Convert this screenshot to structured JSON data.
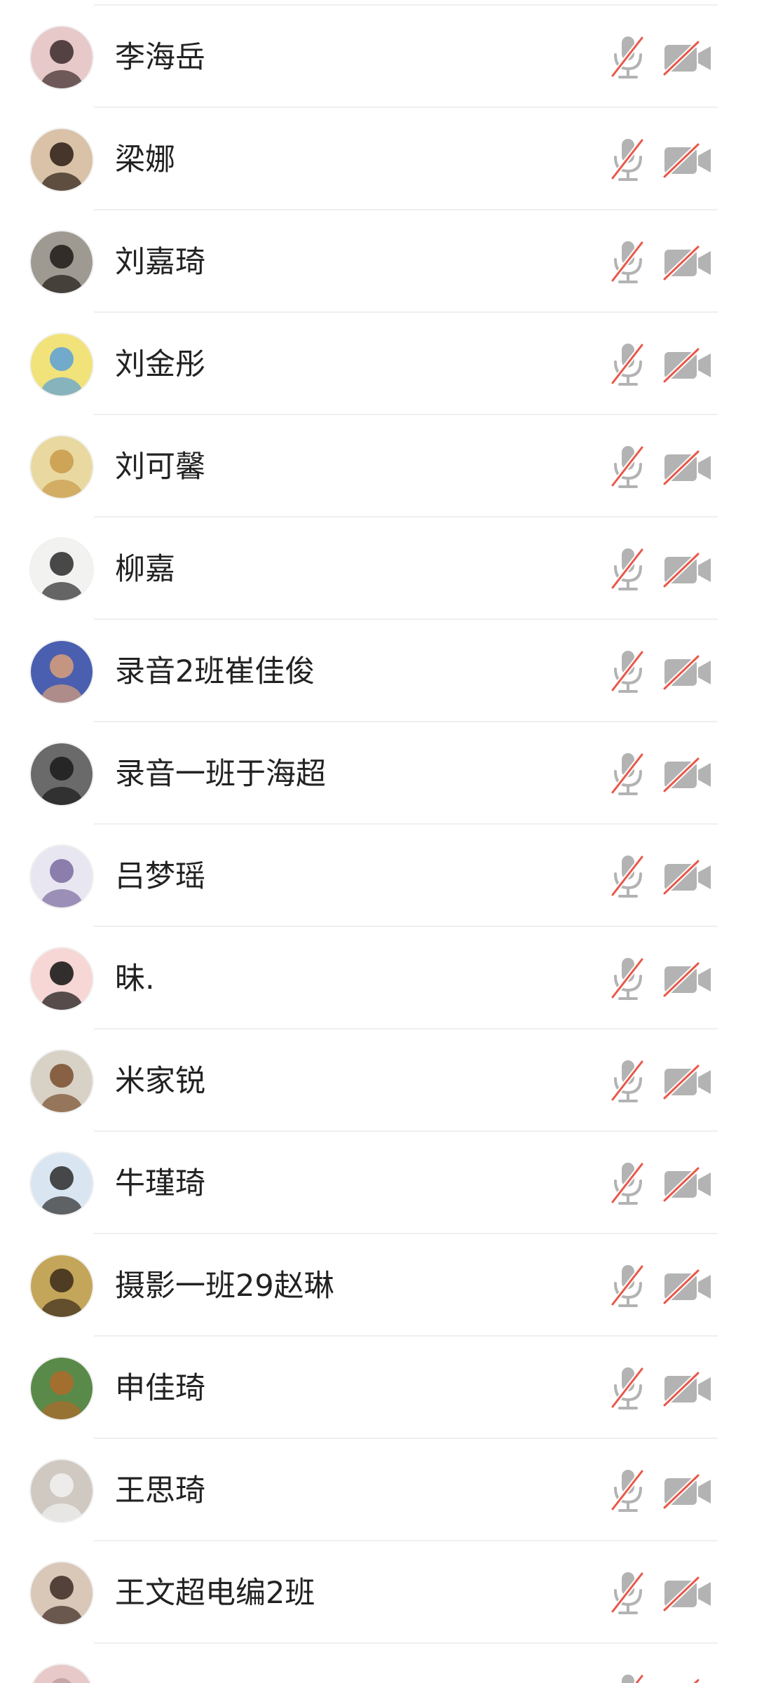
{
  "participants": [
    {
      "name": "李海岳",
      "mic": "muted",
      "camera": "off",
      "avatar": {
        "bg": "#e7c9c9",
        "fg": "#3a2a2a"
      }
    },
    {
      "name": "梁娜",
      "mic": "muted",
      "camera": "off",
      "avatar": {
        "bg": "#d9c2a8",
        "fg": "#2a1c14"
      }
    },
    {
      "name": "刘嘉琦",
      "mic": "muted",
      "camera": "off",
      "avatar": {
        "bg": "#9e9a92",
        "fg": "#1f1a16"
      }
    },
    {
      "name": "刘金彤",
      "mic": "muted",
      "camera": "off",
      "avatar": {
        "bg": "#f1e27a",
        "fg": "#5aa0d8"
      }
    },
    {
      "name": "刘可馨",
      "mic": "muted",
      "camera": "off",
      "avatar": {
        "bg": "#e9d9a0",
        "fg": "#c99a4a"
      }
    },
    {
      "name": "柳嘉",
      "mic": "muted",
      "camera": "off",
      "avatar": {
        "bg": "#f2f2f0",
        "fg": "#2a2a2a"
      }
    },
    {
      "name": "录音2班崔佳俊",
      "mic": "muted",
      "camera": "off",
      "avatar": {
        "bg": "#4a5fb0",
        "fg": "#d9a07a"
      }
    },
    {
      "name": "录音一班于海超",
      "mic": "muted",
      "camera": "off",
      "avatar": {
        "bg": "#6a6a6a",
        "fg": "#1a1a1a"
      }
    },
    {
      "name": "吕梦瑶",
      "mic": "muted",
      "camera": "off",
      "avatar": {
        "bg": "#e8e6f0",
        "fg": "#7a6aa0"
      }
    },
    {
      "name": "昧.",
      "mic": "muted",
      "camera": "off",
      "avatar": {
        "bg": "#f7d6d6",
        "fg": "#111111"
      }
    },
    {
      "name": "米家锐",
      "mic": "muted",
      "camera": "off",
      "avatar": {
        "bg": "#d8d2c6",
        "fg": "#7a4e2e"
      }
    },
    {
      "name": "牛瑾琦",
      "mic": "muted",
      "camera": "off",
      "avatar": {
        "bg": "#d9e6f2",
        "fg": "#2a2a2a"
      }
    },
    {
      "name": "摄影一班29赵琳",
      "mic": "muted",
      "camera": "off",
      "avatar": {
        "bg": "#c4a65a",
        "fg": "#3a2a1a"
      }
    },
    {
      "name": "申佳琦",
      "mic": "muted",
      "camera": "off",
      "avatar": {
        "bg": "#5a8a4a",
        "fg": "#b06a2a"
      }
    },
    {
      "name": "王思琦",
      "mic": "muted",
      "camera": "off",
      "avatar": {
        "bg": "#cfc9c2",
        "fg": "#f2f2f2"
      }
    },
    {
      "name": "王文超电编2班",
      "mic": "muted",
      "camera": "off",
      "avatar": {
        "bg": "#d9c7b8",
        "fg": "#3a2a22"
      }
    },
    {
      "name": "",
      "mic": "muted",
      "camera": "off",
      "avatar": {
        "bg": "#e8c9c9",
        "fg": "#c0a0a0"
      }
    }
  ],
  "colors": {
    "icon_gray": "#b3b3b3",
    "slash_red": "#e8584a",
    "divider": "#efefef",
    "text": "#222222"
  }
}
